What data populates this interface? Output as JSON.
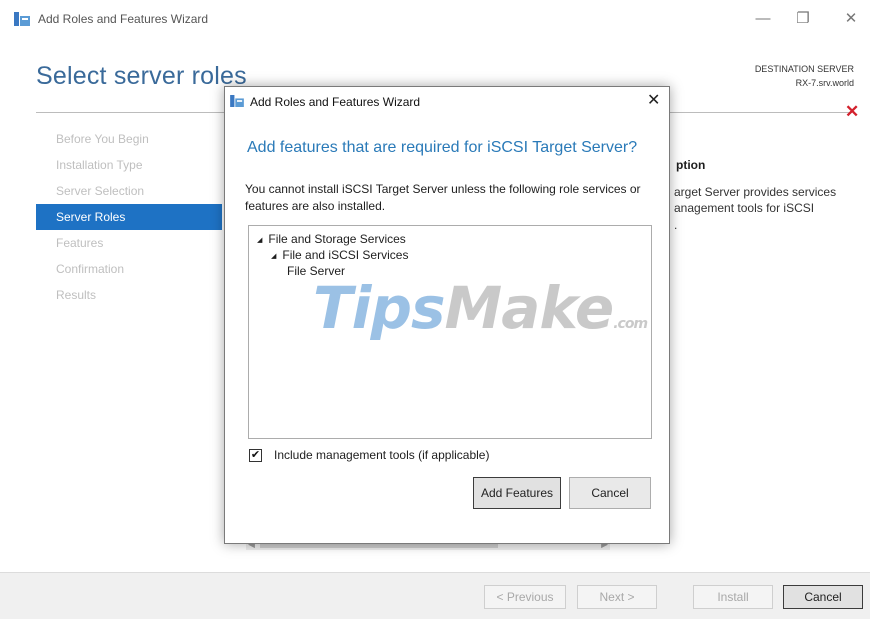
{
  "window": {
    "title": "Add Roles and Features Wizard",
    "minimize": "—",
    "maximize": "❐",
    "close": "✕"
  },
  "page": {
    "title": "Select server roles",
    "destination_label": "DESTINATION SERVER",
    "destination_server": "RX-7.srv.world",
    "error_glyph": "✕"
  },
  "steps": [
    {
      "label": "Before You Begin",
      "active": false
    },
    {
      "label": "Installation Type",
      "active": false
    },
    {
      "label": "Server Selection",
      "active": false
    },
    {
      "label": "Server Roles",
      "active": true
    },
    {
      "label": "Features",
      "active": false
    },
    {
      "label": "Confirmation",
      "active": false
    },
    {
      "label": "Results",
      "active": false
    }
  ],
  "description": {
    "heading": "ption",
    "line1": "arget Server provides services",
    "line2": "anagement tools for iSCSI",
    "line3": "."
  },
  "scrollbar": {
    "left_arrow": "◀",
    "right_arrow": "▶"
  },
  "footer": {
    "previous": "< Previous",
    "next": "Next >",
    "install": "Install",
    "cancel": "Cancel"
  },
  "dialog": {
    "title": "Add Roles and Features Wizard",
    "close": "✕",
    "heading": "Add features that are required for iSCSI Target Server?",
    "message": "You cannot install iSCSI Target Server unless the following role services or features are also installed.",
    "tree": [
      {
        "label": "File and Storage Services",
        "expander": "◢"
      },
      {
        "label": "File and iSCSI Services",
        "expander": "◢"
      },
      {
        "label": "File Server",
        "expander": ""
      }
    ],
    "watermark": {
      "t": "T",
      "ips": "ips",
      "make": "Make",
      "com": ".com"
    },
    "include_tools_checked": true,
    "check_glyph": "✔",
    "include_tools_label": "Include management tools (if applicable)",
    "add_features": "Add Features",
    "cancel": "Cancel"
  },
  "colors": {
    "accent": "#1e72c4",
    "heading_blue": "#2a7ab8",
    "error_red": "#d3212d"
  }
}
